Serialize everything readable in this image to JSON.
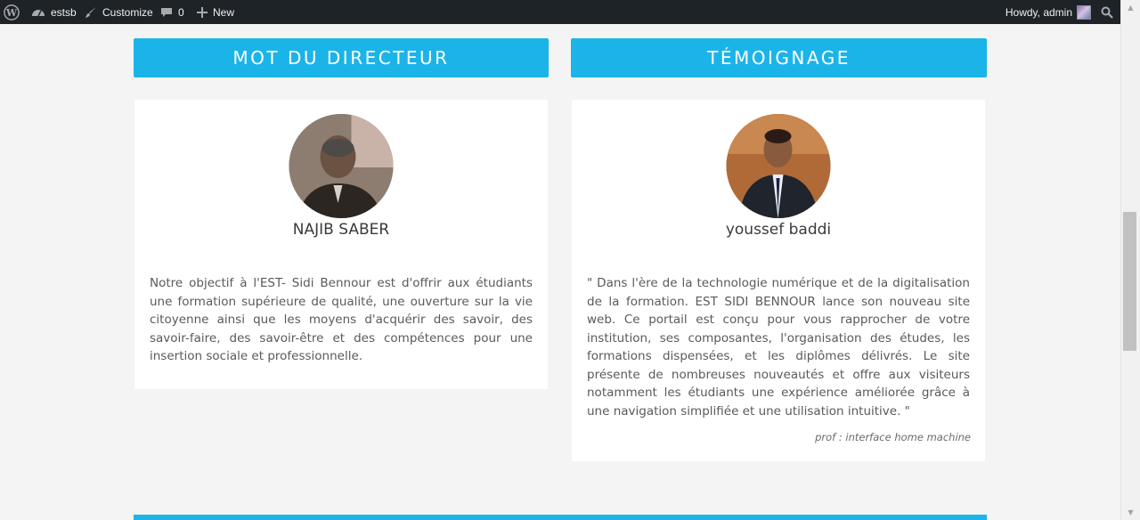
{
  "adminbar": {
    "wp_logo_icon": "wordpress-logo-icon",
    "site_name": "estsb",
    "customize_label": "Customize",
    "comments_count": "0",
    "new_label": "New",
    "howdy_label": "Howdy, admin"
  },
  "sections": {
    "left_title": "MOT DU DIRECTEUR",
    "right_title": "TÉMOIGNAGE"
  },
  "director": {
    "name": "NAJIB SABER",
    "text": "Notre objectif à l'EST- Sidi Bennour est d'offrir aux étudiants une formation supérieure de qualité, une ouverture sur la vie citoyenne ainsi que les moyens d'acquérir des savoir, des savoir-faire, des savoir-être et des compétences pour une insertion sociale et professionnelle."
  },
  "testimony": {
    "name": "youssef baddi",
    "text": "\" Dans l'ère de la technologie numérique et de la digitalisation de la formation. EST SIDI BENNOUR lance son nouveau site web. Ce portail est conçu pour vous rapprocher de votre institution, ses composantes, l'organisation des études, les formations dispensées, et les diplômes délivrés. Le site présente de nombreuses nouveautés et offre aux visiteurs notamment les étudiants une expérience améliorée grâce à une navigation simplifiée et une utilisation intuitive. \"",
    "signature": "prof : interface home machine"
  },
  "colors": {
    "accent": "#1bb4e8",
    "adminbar_bg": "#1d2327",
    "page_bg": "#f4f4f4"
  }
}
